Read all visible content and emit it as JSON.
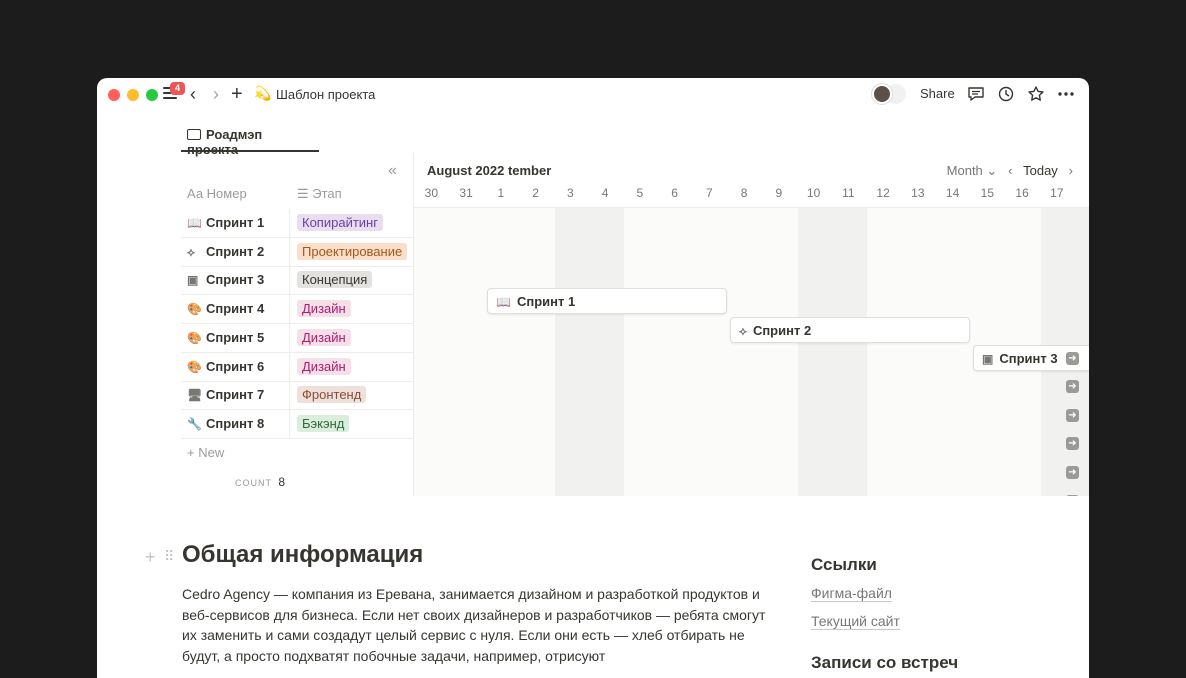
{
  "titlebar": {
    "badge_count": "4",
    "page_emoji": "💫",
    "page_title": "Шаблон проекта",
    "share_label": "Share"
  },
  "tab": {
    "label": "Роадмэп проекта"
  },
  "table": {
    "columns": {
      "name": "Аа Номер",
      "stage": "☰ Этап"
    },
    "rows": [
      {
        "icon": "book-icon",
        "glyph": "📖",
        "name": "Спринт 1",
        "stage": "Копирайтинг",
        "stage_color": "#e8deee",
        "stage_text": "#6940a5"
      },
      {
        "icon": "vector-icon",
        "glyph": "⟡",
        "name": "Спринт 2",
        "stage": "Проектирование",
        "stage_color": "#fadec9",
        "stage_text": "#9f5a1c"
      },
      {
        "icon": "image-icon",
        "glyph": "▣",
        "name": "Спринт 3",
        "stage": "Концепция",
        "stage_color": "#e3e2e0",
        "stage_text": "#37352f"
      },
      {
        "icon": "palette-icon",
        "glyph": "🎨",
        "name": "Спринт 4",
        "stage": "Дизайн",
        "stage_color": "#f5e0e9",
        "stage_text": "#ad1a72"
      },
      {
        "icon": "palette-icon",
        "glyph": "🎨",
        "name": "Спринт 5",
        "stage": "Дизайн",
        "stage_color": "#f5e0e9",
        "stage_text": "#ad1a72"
      },
      {
        "icon": "palette-icon",
        "glyph": "🎨",
        "name": "Спринт 6",
        "stage": "Дизайн",
        "stage_color": "#f5e0e9",
        "stage_text": "#ad1a72"
      },
      {
        "icon": "monitor-icon",
        "glyph": "🖥",
        "name": "Спринт 7",
        "stage": "Фронтенд",
        "stage_color": "#eee0da",
        "stage_text": "#8d4a32"
      },
      {
        "icon": "wrench-icon",
        "glyph": "🔧",
        "name": "Спринт 8",
        "stage": "Бэкэнд",
        "stage_color": "#dbeddb",
        "stage_text": "#2b6b3a"
      }
    ],
    "new_label": "New",
    "count_label": "COUNT",
    "count_value": "8"
  },
  "timeline": {
    "month_label": "August 2022",
    "month_next_fragment": "tember",
    "view_label": "Month",
    "today_label": "Today",
    "days": [
      "30",
      "31",
      "1",
      "2",
      "3",
      "4",
      "5",
      "6",
      "7",
      "8",
      "9",
      "10",
      "11",
      "12",
      "13",
      "14",
      "15",
      "16",
      "17"
    ],
    "bars": [
      {
        "label": "Спринт 1",
        "glyph": "📖"
      },
      {
        "label": "Спринт 2",
        "glyph": "⟡"
      },
      {
        "label": "Спринт 3",
        "glyph": "▣"
      }
    ]
  },
  "content": {
    "heading": "Общая информация",
    "paragraph": "Cedro Agency — компания из Еревана, занимается дизайном и разработкой продуктов и веб-сервисов для бизнеса. Если нет своих дизайнеров и разработчиков — ребята смогут их заменить и сами создадут целый сервис с нуля. Если они есть — хлеб отбирать не будут, а просто подхватят побочные задачи, например, отрисуют",
    "links_heading": "Ссылки",
    "links": [
      "Фигма-файл",
      "Текущий сайт"
    ],
    "meetings_heading": "Записи со встреч"
  }
}
